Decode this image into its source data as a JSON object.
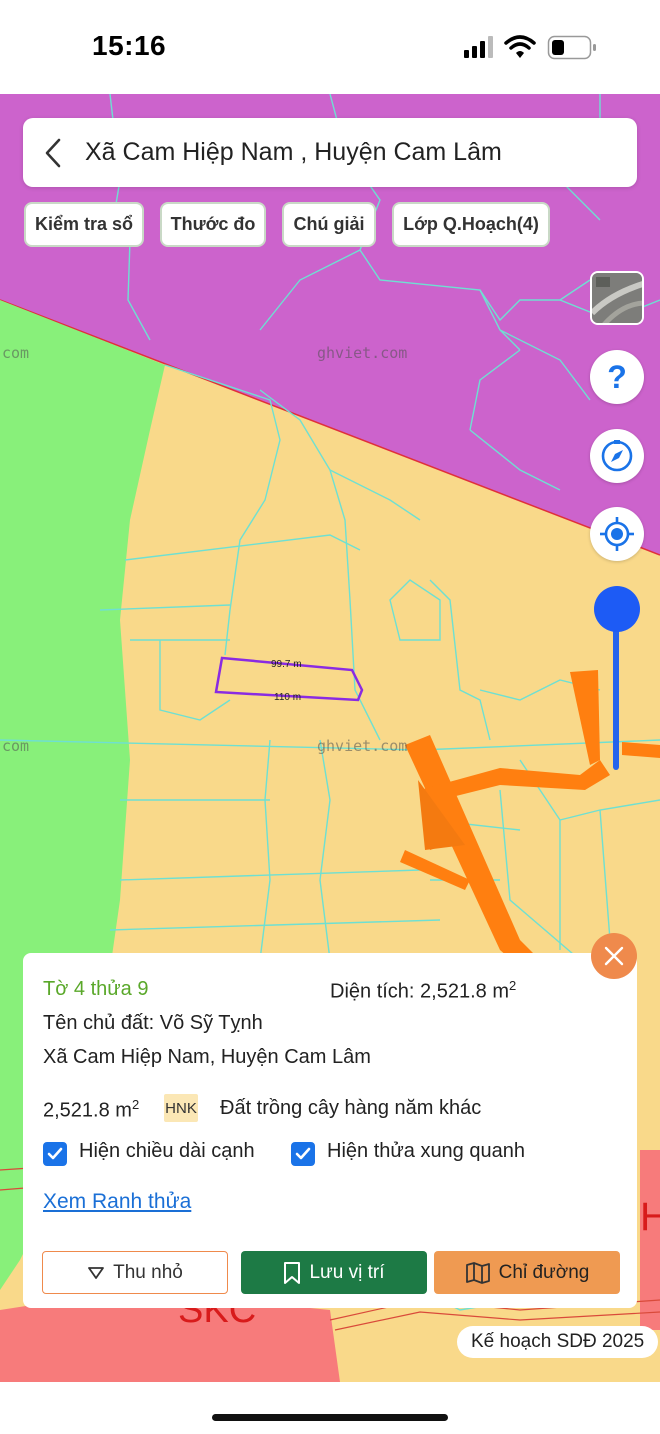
{
  "status": {
    "time": "15:16"
  },
  "search": {
    "title": "Xã Cam Hiệp Nam , Huyện Cam Lâm"
  },
  "chips": [
    "Kiểm tra sổ",
    "Thước đo",
    "Chú giải",
    "Lớp Q.Hoạch(4)"
  ],
  "map": {
    "watermarks": [
      "ghviet.com",
      "com",
      "ghviet.com",
      "com"
    ],
    "measure_top": "99.7 m",
    "measure_bottom": "110 m",
    "zone_label": "SKC",
    "zone_label_right": "H",
    "colors": {
      "agri": "#f9d98a",
      "forest": "#88f07a",
      "residential": "#cc63cc",
      "road": "#ff7f10",
      "industrial": "#f77b7b",
      "parcel_line": "#6ee0d2",
      "selected": "#8a2be2"
    }
  },
  "controls": {
    "layer_thumb": "satellite-thumb",
    "help": "help-icon",
    "compass": "compass-icon",
    "locate": "locate-icon"
  },
  "panel": {
    "parcel": "Tờ 4 thửa 9",
    "area_label": "Diện tích: 2,521.8 m",
    "area_sup": "2",
    "owner": "Tên chủ đất: Võ Sỹ Tỵnh",
    "address": "Xã Cam Hiệp Nam, Huyện Cam Lâm",
    "landuse_area": "2,521.8 m",
    "landuse_sup": "2",
    "landuse_code": "HNK",
    "landuse_desc": "Đất trồng cây hàng năm khác",
    "check_edges": "Hiện chiều dài cạnh",
    "check_neighbors": "Hiện thửa xung quanh",
    "link": "Xem Ranh thửa",
    "btn_collapse": "Thu nhỏ",
    "btn_save": "Lưu vị trí",
    "btn_route": "Chỉ đường"
  },
  "plan_label": "Kế hoạch SDĐ 2025"
}
